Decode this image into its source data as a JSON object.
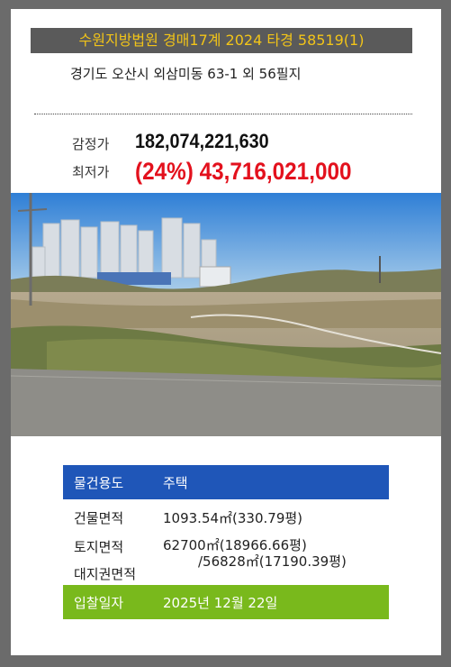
{
  "case": {
    "title": "수원지방법원 경매17계 2024 타경 58519(1)",
    "address": "경기도 오산시 외삼미동 63-1 외 56필지"
  },
  "prices": {
    "appraisal_label": "감정가",
    "appraisal_value": "182,074,221,630",
    "minimum_label": "최저가",
    "minimum_value": "(24%) 43,716,021,000"
  },
  "photo": {
    "description_icon": "land-photo"
  },
  "details": {
    "usage_label": "물건용도",
    "usage_value": "주택",
    "building_area_label": "건물면적",
    "building_area_value": "1093.54㎡(330.79평)",
    "land_area_label": "토지면적",
    "land_area_value": "62700㎡(18966.66평)",
    "land_right_label": "대지권면적",
    "land_right_value": "/56828㎡(17190.39평)",
    "bid_date_label": "입찰일자",
    "bid_date_value": "2025년 12월 22일"
  },
  "colors": {
    "page_bg": "#6b6b6b",
    "banner_bg": "#5a5a5a",
    "banner_text": "#f2c418",
    "min_price": "#e3111d",
    "usage_row": "#1f56b8",
    "date_row": "#79b91c"
  }
}
